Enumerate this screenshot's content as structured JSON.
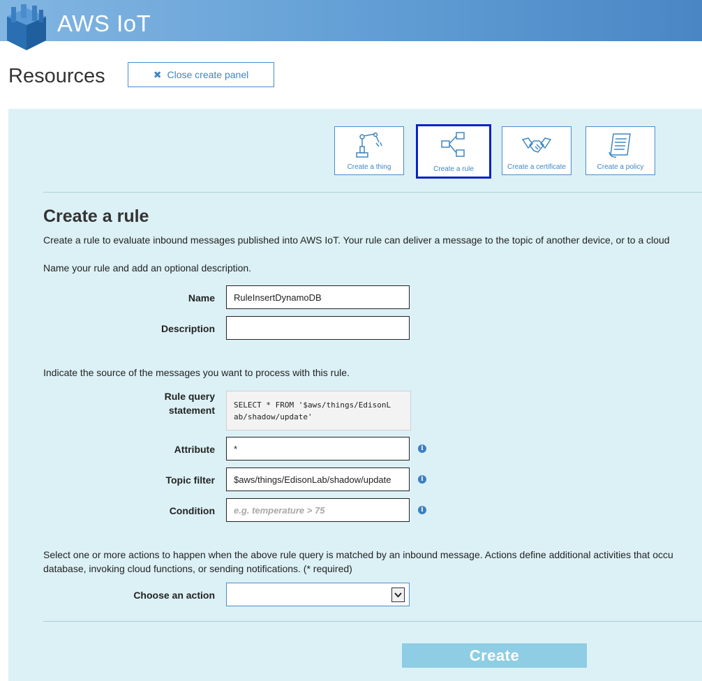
{
  "header": {
    "brand": "AWS IoT"
  },
  "page": {
    "title": "Resources",
    "close_label": "Close create panel"
  },
  "tiles": [
    {
      "label": "Create a thing",
      "icon": "robot-arm-icon"
    },
    {
      "label": "Create a rule",
      "icon": "rule-nodes-icon",
      "active": true
    },
    {
      "label": "Create a certificate",
      "icon": "handshake-icon"
    },
    {
      "label": "Create a policy",
      "icon": "policy-document-icon"
    }
  ],
  "form": {
    "heading": "Create a rule",
    "intro": "Create a rule to evaluate inbound messages published into AWS IoT. Your rule can deliver a message to the topic of another device, or to a cloud",
    "name_prompt": "Name your rule and add an optional description.",
    "name_label": "Name",
    "name_value": "RuleInsertDynamoDB",
    "description_label": "Description",
    "description_value": "",
    "source_prompt": "Indicate the source of the messages you want to process with this rule.",
    "query_label_1": "Rule query",
    "query_label_2": "statement",
    "query_line_1": "SELECT * FROM '$aws/things/EdisonL",
    "query_line_2": "ab/shadow/update'",
    "attribute_label": "Attribute",
    "attribute_value": "*",
    "topic_label": "Topic filter",
    "topic_value": "$aws/things/EdisonLab/shadow/update",
    "condition_label": "Condition",
    "condition_placeholder": "e.g. temperature > 75",
    "actions_prompt_1": "Select one or more actions to happen when the above rule query is matched by an inbound message. Actions define additional activities that occu",
    "actions_prompt_2": "database, invoking cloud functions, or sending notifications. (* required)",
    "action_label": "Choose an action",
    "action_value": "",
    "create_label": "Create"
  },
  "colors": {
    "header": "#5e9bd3",
    "panel": "#dcf1f6",
    "accent": "#3f86c2",
    "active_border": "#0b22c8",
    "create_button": "#8ecde4"
  }
}
